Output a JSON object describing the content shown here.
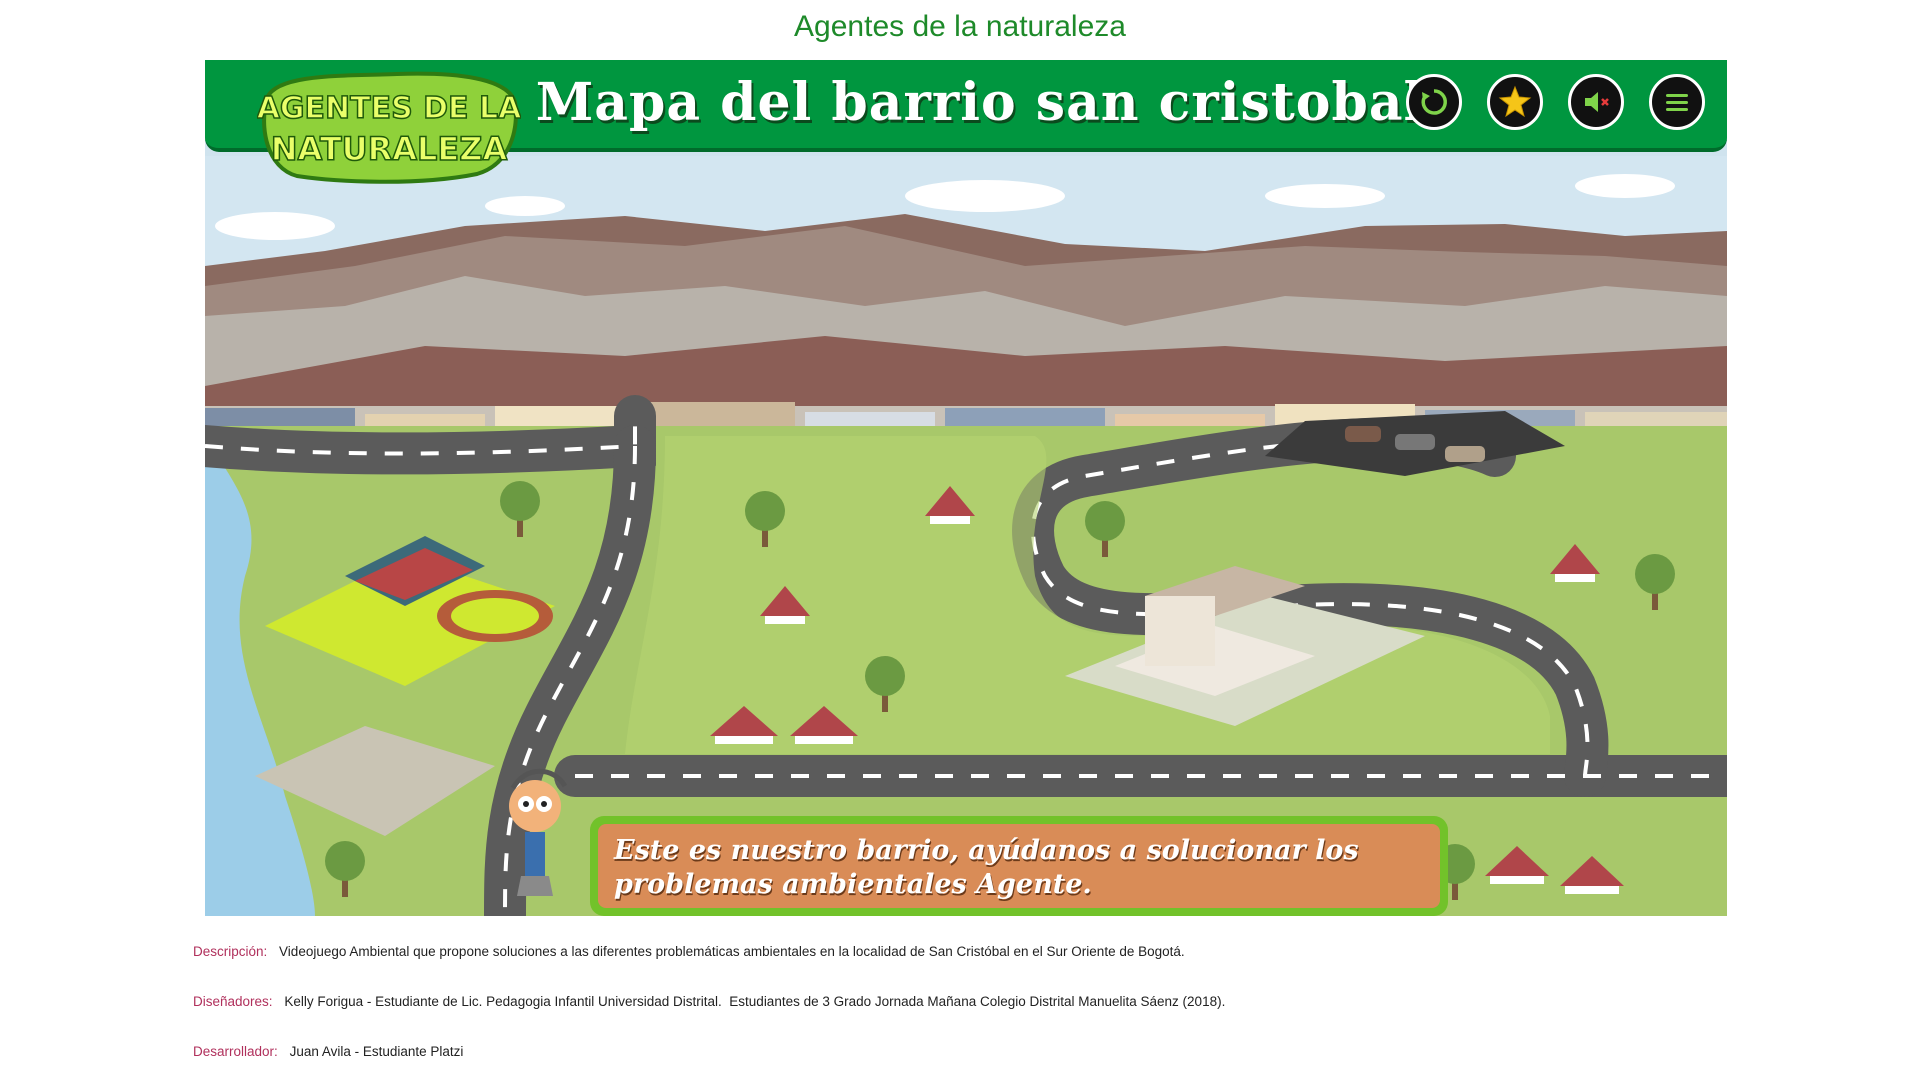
{
  "page": {
    "title": "Agentes de la naturaleza"
  },
  "game": {
    "logo_line1": "AGENTES DE LA",
    "logo_line2": "NATURALEZA",
    "title": "Mapa del barrio san cristobal",
    "buttons": [
      {
        "name": "restart-button",
        "icon": "restart-icon"
      },
      {
        "name": "star-button",
        "icon": "star-icon"
      },
      {
        "name": "sound-button",
        "icon": "speaker-muted-icon"
      },
      {
        "name": "menu-button",
        "icon": "hamburger-menu-icon"
      }
    ],
    "dialog_text": "Este es nuestro barrio, ayúdanos a solucionar los problemas ambientales Agente.",
    "colors": {
      "bar": "#00963f",
      "dialog_border": "#72c22a",
      "dialog_fill": "#d98c57"
    }
  },
  "meta": {
    "description_label": "Descripción:",
    "description": "Videojuego Ambiental que propone soluciones a las diferentes problemáticas ambientales en la localidad de San Cristóbal en el Sur Oriente de Bogotá.",
    "designers_label": "Diseñadores:",
    "designers": "Kelly Forigua - Estudiante de Lic. Pedagogia Infantil Universidad Distrital.  Estudiantes de 3 Grado Jornada Mañana Colegio Distrital Manuelita Sáenz (2018).",
    "developer_label": "Desarrollador:",
    "developer": "Juan Avila - Estudiante Platzi"
  }
}
